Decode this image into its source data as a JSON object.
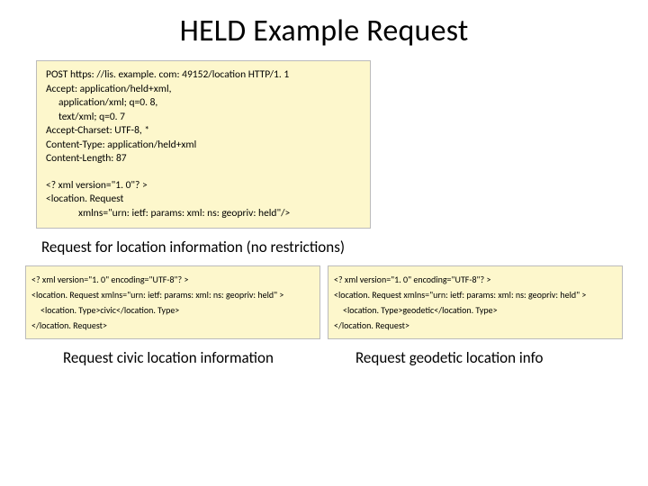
{
  "title": "HELD Example Request",
  "box1": {
    "l1": "POST https: //lis. example. com: 49152/location HTTP/1. 1",
    "l2": "Accept: application/held+xml,",
    "l3": "application/xml; q=0. 8,",
    "l4": "text/xml; q=0. 7",
    "l5": "Accept-Charset: UTF-8, *",
    "l6": "Content-Type: application/held+xml",
    "l7": "Content-Length: 87",
    "l8": "<? xml version=\"1. 0\"? >",
    "l9": "<location. Request",
    "l10": "xmlns=\"urn: ietf: params: xml: ns: geopriv: held\"/>"
  },
  "subtitle1": "Request for location information (no restrictions)",
  "box2": {
    "l1": "<? xml version=\"1. 0\" encoding=\"UTF-8\"? >",
    "l2": "<location. Request xmlns=\"urn: ietf: params: xml: ns: geopriv: held\" >",
    "l3": "<location. Type>civic</location. Type>",
    "l4": "</location. Request>"
  },
  "box3": {
    "l1": "<? xml version=\"1. 0\" encoding=\"UTF-8\"? >",
    "l2": "<location. Request xmlns=\"urn: ietf: params: xml: ns: geopriv: held\" >",
    "l3": "<location. Type>geodetic</location. Type>",
    "l4": "</location. Request>"
  },
  "subtitle2": "Request civic location information",
  "subtitle3": "Request geodetic location info"
}
